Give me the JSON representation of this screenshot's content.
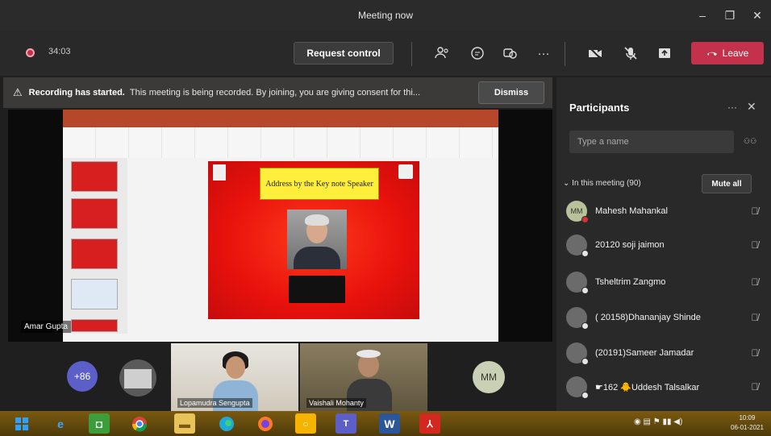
{
  "window": {
    "title": "Meeting now",
    "minimize": "–",
    "maximize": "❐",
    "close": "✕"
  },
  "toolbar": {
    "timer": "34:03",
    "request_control": "Request control",
    "more": "···",
    "leave": "Leave",
    "icons": [
      "participants-icon",
      "chat-icon",
      "reactions-icon",
      "more-icon",
      "camera-off-icon",
      "mic-off-icon",
      "share-icon",
      "phone-icon"
    ]
  },
  "banner": {
    "icon": "⚠",
    "bold": "Recording has started.",
    "message": "This meeting is being recorded. By joining, you are giving consent for thi...",
    "dismiss": "Dismiss"
  },
  "stage": {
    "slide_header": "Address by the Key note Speaker",
    "presenter_label": "Amar Gupta"
  },
  "bottom": {
    "more_count": "+86",
    "video1_label": "Lopamudra Sengupta",
    "video2_label": "Vaishali Mohanty",
    "mm_initials": "MM"
  },
  "panel": {
    "title": "Participants",
    "more": "···",
    "close": "✕",
    "search_placeholder": "Type a name",
    "search_option": "⚇⚇",
    "section": "⌄ In this meeting (90)",
    "mute_all": "Mute all",
    "participants": [
      {
        "initials": "MM",
        "name": "Mahesh Mahankal"
      },
      {
        "initials": "",
        "name": "20120 soji jaimon"
      },
      {
        "initials": "",
        "name": "Tsheltrim Zangmo"
      },
      {
        "initials": "",
        "name": "( 20158)Dhananjay Shinde"
      },
      {
        "initials": "",
        "name": "(20191)Sameer Jamadar"
      },
      {
        "initials": "",
        "name": "☛162 🐥Uddesh Talsalkar"
      }
    ]
  },
  "taskbar": {
    "clock_time": "10:09",
    "clock_date": "06-01-2021"
  },
  "colors": {
    "leave": "#c4314b",
    "accent": "#5b5fc7",
    "slide_red": "#e8110c",
    "slide_yellow": "#ffef3a"
  }
}
